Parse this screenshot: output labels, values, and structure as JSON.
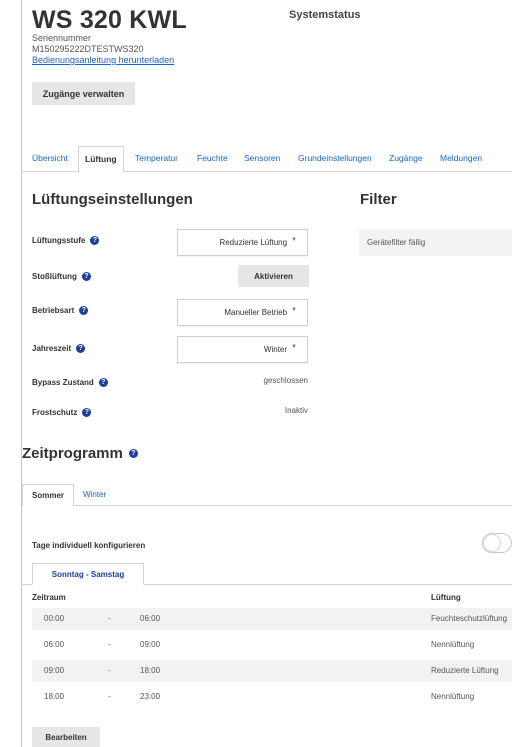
{
  "header": {
    "device_title": "WS 320 KWL",
    "system_status": "Systemstatus",
    "serial_label": "Seriennummer",
    "serial_value": "M150295222DTESTWS320",
    "manual_link": "Bedienungsanleitung herunterladen",
    "access_button": "Zugänge verwalten"
  },
  "tabs": [
    {
      "label": "Übersicht",
      "active": false
    },
    {
      "label": "Lüftung",
      "active": true
    },
    {
      "label": "Temperatur",
      "active": false
    },
    {
      "label": "Feuchte",
      "active": false
    },
    {
      "label": "Sensoren",
      "active": false
    },
    {
      "label": "Grundeinstellungen",
      "active": false
    },
    {
      "label": "Zugänge",
      "active": false
    },
    {
      "label": "Meldungen",
      "active": false
    }
  ],
  "ventilation": {
    "heading": "Lüftungseinstellungen",
    "fields": {
      "stufe": {
        "label": "Lüftungsstufe",
        "value": "Reduzierte Lüftung"
      },
      "stoss": {
        "label": "Stoßlüftung",
        "button": "Aktivieren"
      },
      "betriebsart": {
        "label": "Betriebsart",
        "value": "Manueller Betrieb"
      },
      "jahreszeit": {
        "label": "Jahreszeit",
        "value": "Winter"
      },
      "bypass": {
        "label": "Bypass Zustand",
        "value": "geschlossen"
      },
      "frost": {
        "label": "Frostschutz",
        "value": "Inaktiv"
      }
    }
  },
  "filter": {
    "heading": "Filter",
    "status": "Gerätefilter fällig"
  },
  "schedule": {
    "heading": "Zeitprogramm",
    "season_tabs": [
      {
        "label": "Sommer",
        "active": true
      },
      {
        "label": "Winter",
        "active": false
      }
    ],
    "individual_days_label": "Tage individuell konfigurieren",
    "individual_days_enabled": false,
    "day_tab": "Sonntag - Samstag",
    "columns": {
      "range": "Zeitraum",
      "ventilation": "Lüftung"
    },
    "rows": [
      {
        "from": "00:00",
        "sep": "-",
        "to": "06:00",
        "mode": "Feuchteschutzlüftung"
      },
      {
        "from": "06:00",
        "sep": "-",
        "to": "09:00",
        "mode": "Nennlüftung"
      },
      {
        "from": "09:00",
        "sep": "-",
        "to": "18:00",
        "mode": "Reduzierte Lüftung"
      },
      {
        "from": "18:00",
        "sep": "-",
        "to": "23:00",
        "mode": "Nennlüftung"
      }
    ],
    "edit_button": "Bearbeiten"
  },
  "icons": {
    "help": "question-circle-icon",
    "caret": "caret-down-icon"
  },
  "colors": {
    "link": "#1a64c8",
    "help_icon": "#1a3f9c",
    "button_bg": "#e6e6e6",
    "row_alt": "#f2f2f2"
  }
}
